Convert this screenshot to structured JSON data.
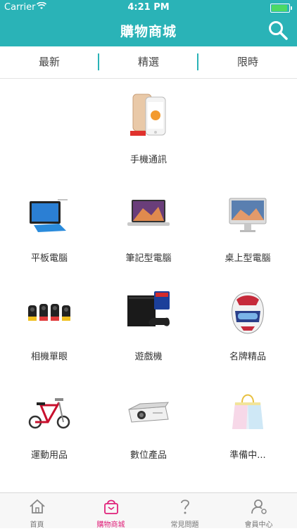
{
  "status_bar": {
    "carrier": "Carrier",
    "time": "4:21 PM"
  },
  "header": {
    "title": "購物商城",
    "search_icon": "search-icon"
  },
  "tabs": [
    {
      "label": "最新"
    },
    {
      "label": "精選"
    },
    {
      "label": "限時"
    }
  ],
  "categories": [
    {
      "label": "手機通訊",
      "icon": "smartphone-image"
    },
    {
      "label": "平板電腦",
      "icon": "tablet-image"
    },
    {
      "label": "筆記型電腦",
      "icon": "laptop-image"
    },
    {
      "label": "桌上型電腦",
      "icon": "desktop-image"
    },
    {
      "label": "相機單眼",
      "icon": "camera-image"
    },
    {
      "label": "遊戲機",
      "icon": "game-console-image"
    },
    {
      "label": "名牌精品",
      "icon": "helmet-image"
    },
    {
      "label": "運動用品",
      "icon": "bicycle-image"
    },
    {
      "label": "數位產品",
      "icon": "projector-image"
    },
    {
      "label": "準備中...",
      "icon": "shopping-bag-image"
    }
  ],
  "tab_bar": [
    {
      "label": "首頁",
      "icon": "home-icon"
    },
    {
      "label": "購物商城",
      "icon": "shopping-bag-icon"
    },
    {
      "label": "常見問題",
      "icon": "question-icon"
    },
    {
      "label": "會員中心",
      "icon": "user-icon"
    }
  ],
  "colors": {
    "primary": "#2ab3b7",
    "active_tab": "#e0217a",
    "battery": "#4cd964"
  }
}
